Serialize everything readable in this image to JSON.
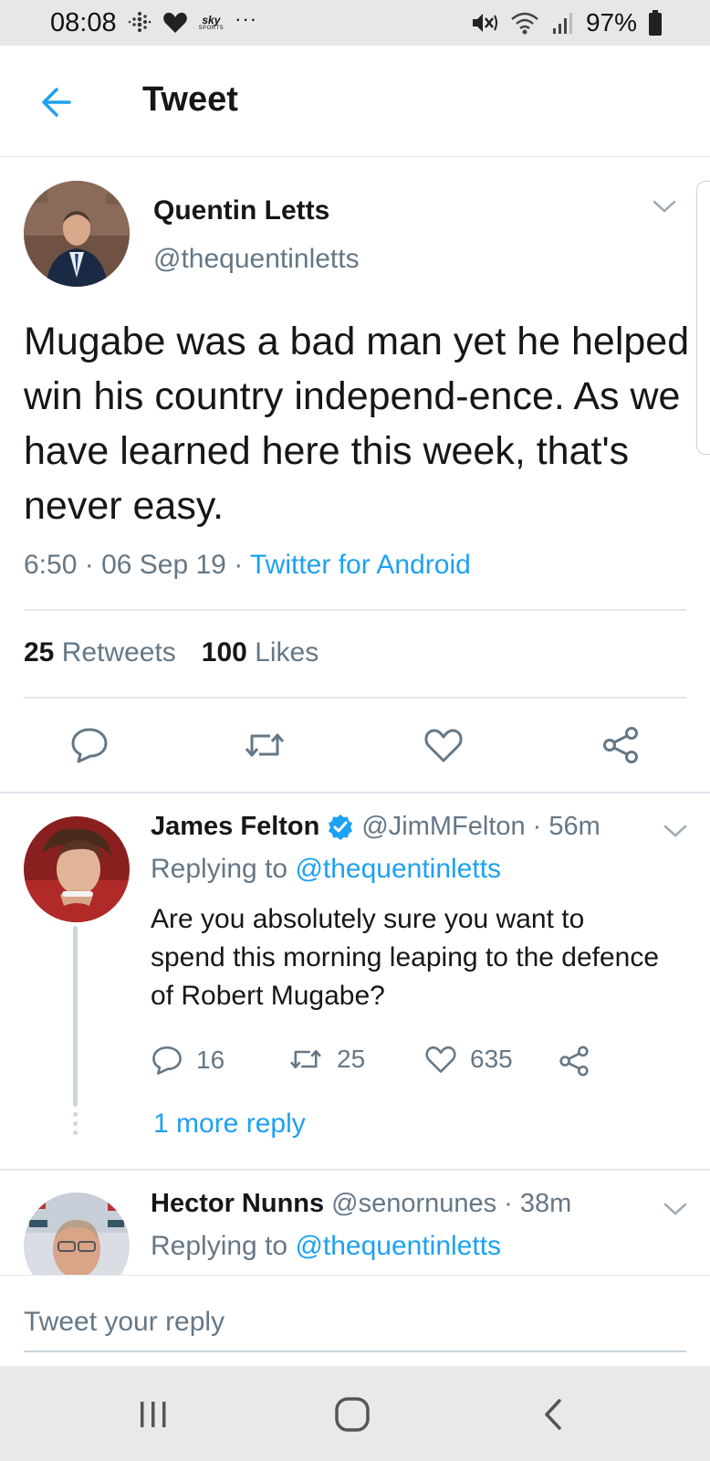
{
  "status_bar": {
    "time": "08:08",
    "battery": "97%",
    "icons": [
      "fitbit-icon",
      "heart-icon",
      "sky-sports-icon",
      "more-dots-icon",
      "mute-icon",
      "wifi-icon",
      "signal-icon",
      "battery-icon"
    ],
    "sky_logo_top": "sky",
    "sky_logo_bottom": "SPORTS",
    "more_dots": "···"
  },
  "header": {
    "title": "Tweet",
    "back_icon": "arrow-left-icon"
  },
  "main_tweet": {
    "author_name": "Quentin Letts",
    "author_handle": "@thequentinletts",
    "text": "Mugabe was a bad man yet he helped win his country independ-ence. As we have learned here this week, that's never easy.",
    "time": "6:50",
    "date": "06 Sep 19",
    "source": "Twitter for Android",
    "sep": "·",
    "retweets_count": "25",
    "retweets_label": "Retweets",
    "likes_count": "100",
    "likes_label": "Likes"
  },
  "replies": [
    {
      "name": "James Felton",
      "verified": true,
      "handle": "@JimMFelton",
      "time": "56m",
      "sep": "·",
      "replying_label": "Replying to",
      "replying_to": "@thequentinletts",
      "text": "Are you absolutely sure you want to spend this morning leaping to the defence of Robert Mugabe?",
      "replies_count": "16",
      "retweets_count": "25",
      "likes_count": "635",
      "more_replies": "1 more reply"
    },
    {
      "name": "Hector Nunns",
      "handle": "@senornunes",
      "time": "38m",
      "sep": "·",
      "replying_label": "Replying to",
      "replying_to": "@thequentinletts"
    }
  ],
  "compose": {
    "placeholder": "Tweet your reply"
  },
  "colors": {
    "accent": "#1da1f2",
    "text": "#14171a",
    "muted": "#657786",
    "divider": "#e1e8ed"
  }
}
